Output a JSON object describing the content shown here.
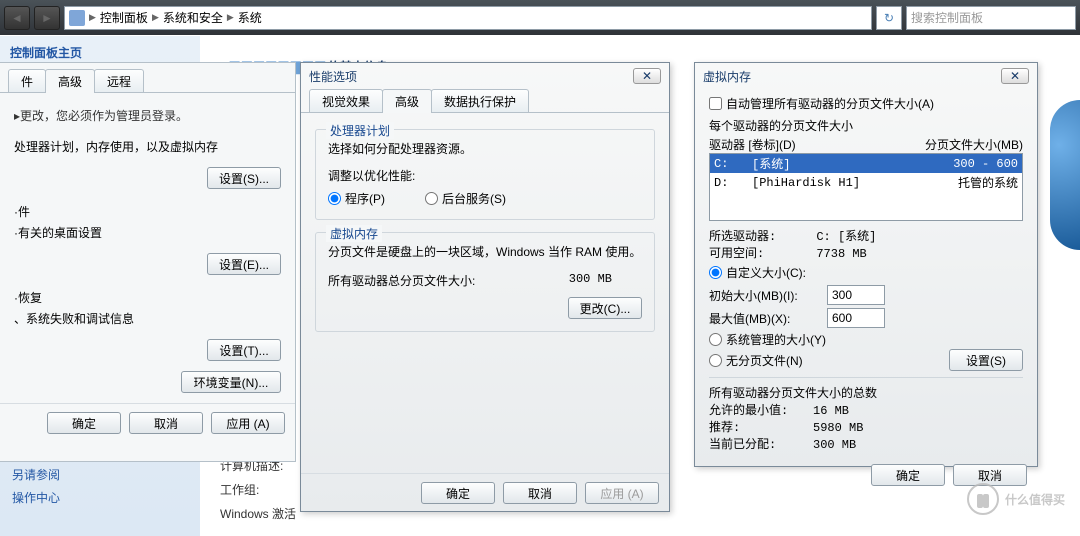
{
  "nav": {
    "crumbs": [
      "控制面板",
      "系统和安全",
      "系统"
    ],
    "search_placeholder": "搜索控制面板"
  },
  "side": {
    "title": "控制面板主页",
    "seealso_title": "另请参阅",
    "seealso_items": [
      "操作中心"
    ]
  },
  "page_title_fragment": "的基本信息",
  "side_info": {
    "desc": "计算机描述:",
    "workgroup": "工作组:",
    "activation": "Windows 激活"
  },
  "sysprops": {
    "tabs": {
      "comp_name": "件",
      "advanced": "高级",
      "remote": "远程"
    },
    "admin_note": "▸更改，您必须作为管理员登录。",
    "grp1_desc": "处理器计划，内存使用，以及虚拟内存",
    "grp2_title": "·件",
    "grp2_desc": "·有关的桌面设置",
    "grp3_title": "·恢复",
    "grp3_desc": "、系统失败和调试信息",
    "btn_settings_s": "设置(S)...",
    "btn_settings_e": "设置(E)...",
    "btn_settings_t": "设置(T)...",
    "btn_env": "环境变量(N)...",
    "ok": "确定",
    "cancel": "取消",
    "apply": "应用 (A)"
  },
  "perf": {
    "title": "性能选项",
    "tabs": {
      "visual": "视觉效果",
      "advanced": "高级",
      "dep": "数据执行保护"
    },
    "sched_legend": "处理器计划",
    "sched_desc": "选择如何分配处理器资源。",
    "adjust_label": "调整以优化性能:",
    "opt_programs": "程序(P)",
    "opt_bgserv": "后台服务(S)",
    "vm_legend": "虚拟内存",
    "vm_desc": "分页文件是硬盘上的一块区域，Windows 当作 RAM 使用。",
    "vm_total_label": "所有驱动器总分页文件大小:",
    "vm_total_value": "300 MB",
    "btn_change": "更改(C)...",
    "ok": "确定",
    "cancel": "取消",
    "apply": "应用 (A)"
  },
  "vm": {
    "title": "虚拟内存",
    "auto_label": "自动管理所有驱动器的分页文件大小(A)",
    "per_drive_label": "每个驱动器的分页文件大小",
    "hdr_drive": "驱动器 [卷标](D)",
    "hdr_pf": "分页文件大小(MB)",
    "drives": [
      {
        "letter": "C:",
        "label": "[系统]",
        "pf": "300 - 600",
        "sel": true
      },
      {
        "letter": "D:",
        "label": "[PhiHardisk H1]",
        "pf": "托管的系统",
        "sel": false
      }
    ],
    "selected_drive_label": "所选驱动器:",
    "selected_drive_value": "C:  [系统]",
    "free_space_label": "可用空间:",
    "free_space_value": "7738 MB",
    "custom_label": "自定义大小(C):",
    "init_label": "初始大小(MB)(I):",
    "init_value": "300",
    "max_label": "最大值(MB)(X):",
    "max_value": "600",
    "sys_managed_label": "系统管理的大小(Y)",
    "no_pf_label": "无分页文件(N)",
    "set_btn": "设置(S)",
    "totals_legend": "所有驱动器分页文件大小的总数",
    "min_label": "允许的最小值:",
    "min_value": "16 MB",
    "rec_label": "推荐:",
    "rec_value": "5980 MB",
    "cur_label": "当前已分配:",
    "cur_value": "300 MB",
    "ok": "确定",
    "cancel": "取消"
  },
  "watermark": "什么值得买"
}
